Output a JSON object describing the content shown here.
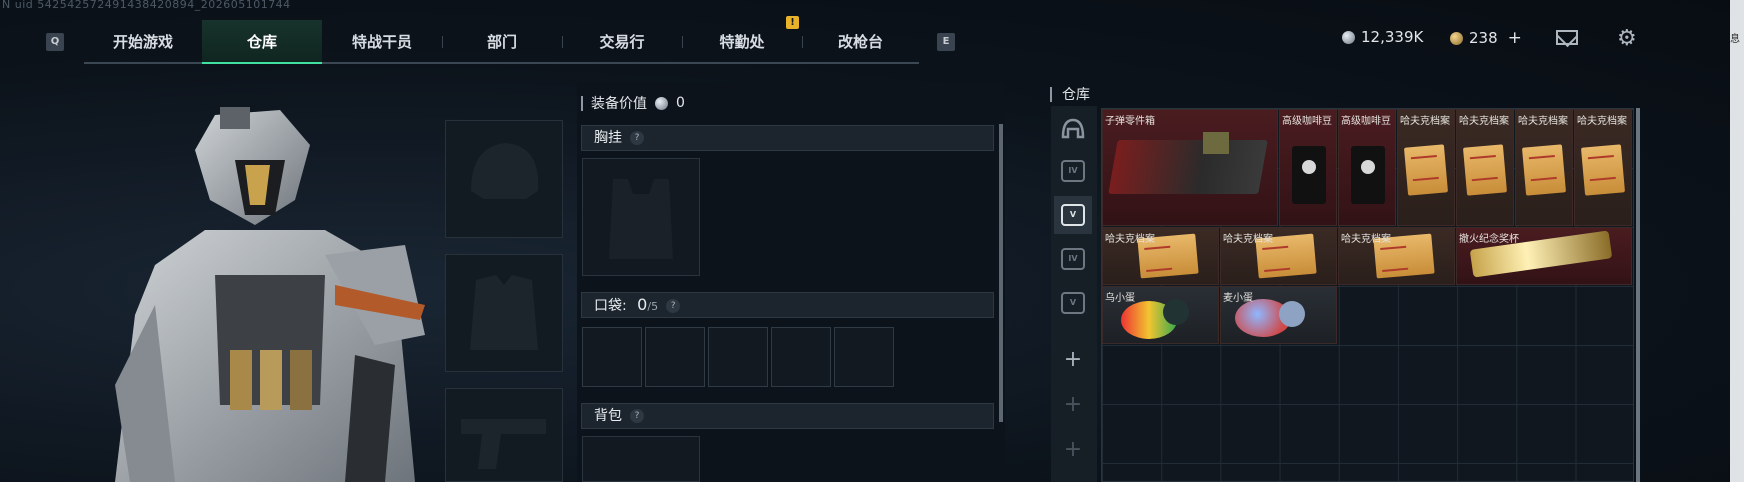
{
  "uid": "N uid 542542572491438420894_202605101744",
  "nav": {
    "key_left": "Q",
    "key_right": "E",
    "tabs": [
      {
        "label": "开始游戏",
        "active": false
      },
      {
        "label": "仓库",
        "active": true
      },
      {
        "label": "特战干员",
        "active": false
      },
      {
        "label": "部门",
        "active": false
      },
      {
        "label": "交易行",
        "active": false
      },
      {
        "label": "特勤处",
        "active": false,
        "alert": "!"
      },
      {
        "label": "改枪台",
        "active": false
      }
    ]
  },
  "currency": {
    "silver": "12,339K",
    "gold": "238",
    "gold_add": "+"
  },
  "header_icons": [
    "mail-icon",
    "gear-icon"
  ],
  "loadout": {
    "equipment_value_label": "装备价值",
    "equipment_value": "0",
    "chest_rig": {
      "label": "胸挂",
      "help": "?"
    },
    "pocket": {
      "label": "口袋:",
      "count": "0",
      "capacity": "/5",
      "help": "?"
    },
    "backpack": {
      "label": "背包",
      "help": "?"
    }
  },
  "storage": {
    "title": "仓库",
    "side_tabs": [
      "helmet-tab-icon",
      "iv-tab-icon",
      "v-tab-icon",
      "iv-tab-icon-2",
      "v-tab-icon-2",
      "add",
      "add",
      "add"
    ],
    "add_symbol": "+",
    "items": [
      {
        "label": "子弹零件箱",
        "rarity": "red"
      },
      {
        "label": "高级咖啡豆",
        "rarity": "red"
      },
      {
        "label": "高级咖啡豆",
        "rarity": "red"
      },
      {
        "label": "哈夫克档案",
        "rarity": "brown"
      },
      {
        "label": "哈夫克档案",
        "rarity": "brown"
      },
      {
        "label": "哈夫克档案",
        "rarity": "brown"
      },
      {
        "label": "哈夫克档案",
        "rarity": "brown"
      },
      {
        "label": "哈夫克档案",
        "rarity": "brown"
      },
      {
        "label": "哈夫克档案",
        "rarity": "brown"
      },
      {
        "label": "哈夫克档案",
        "rarity": "brown"
      },
      {
        "label": "撤火纪念奖杯",
        "rarity": "red"
      },
      {
        "label": "乌小蛋",
        "rarity": "brown"
      },
      {
        "label": "麦小蛋",
        "rarity": "brown"
      }
    ]
  },
  "right_edge_text": "息"
}
